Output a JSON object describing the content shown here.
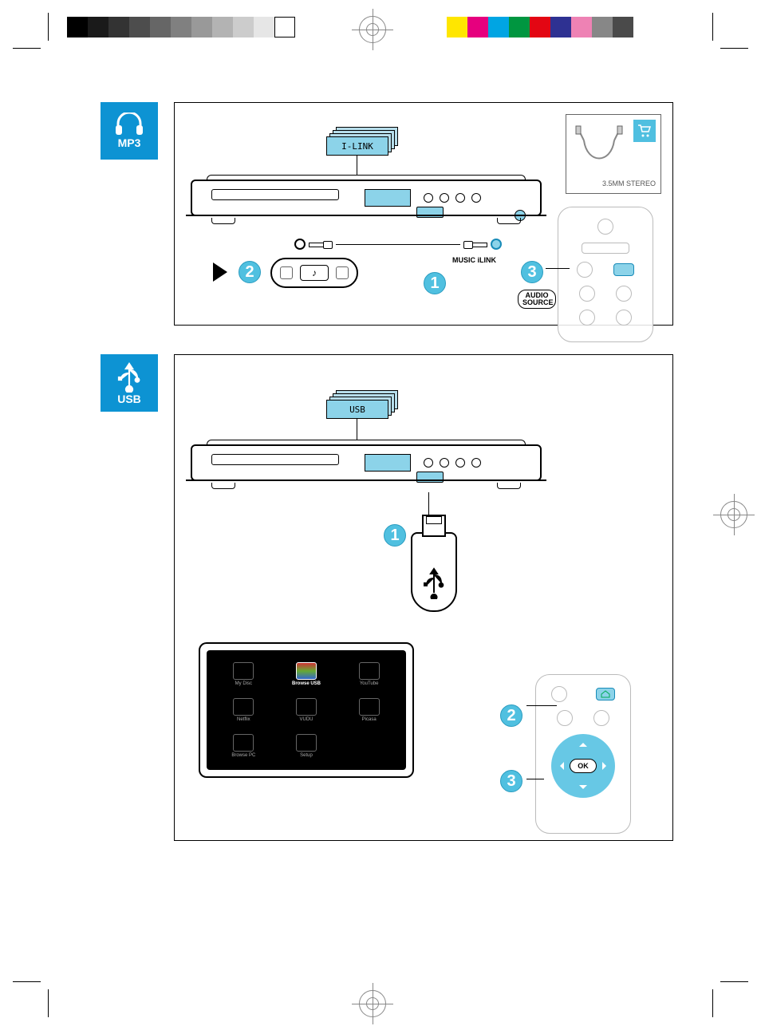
{
  "crop": {
    "grayscale": [
      "#000000",
      "#1a1a1a",
      "#333333",
      "#4d4d4d",
      "#666666",
      "#808080",
      "#999999",
      "#b3b3b3",
      "#cccccc",
      "#e6e6e6",
      "#ffffff"
    ],
    "cmyk": [
      "#ffe600",
      "#e6007e",
      "#00a5e3",
      "#009640",
      "#e30613",
      "#2e3192",
      "#ee82b4",
      "#878787",
      "#4a4a4a"
    ]
  },
  "sections": {
    "mp3": {
      "icon_label": "MP3",
      "display_text": "I-LINK",
      "port_label": "MUSIC iLINK",
      "remote_btn": "AUDIO SOURCE",
      "accessory_label": "3.5MM STEREO",
      "steps": {
        "connect": "1",
        "play": "2",
        "source": "3"
      }
    },
    "usb": {
      "icon_label": "USB",
      "display_text": "USB",
      "steps": {
        "plug": "1",
        "home": "2",
        "ok": "3"
      },
      "remote_ok": "OK",
      "menu": {
        "tiles": [
          {
            "label": "My Disc"
          },
          {
            "label": "Browse USB",
            "highlight": true
          },
          {
            "label": "YouTube"
          },
          {
            "label": "Netflix"
          },
          {
            "label": "VUDU"
          },
          {
            "label": "Picasa"
          },
          {
            "label": "Browse PC"
          },
          {
            "label": "Setup"
          }
        ]
      }
    }
  }
}
